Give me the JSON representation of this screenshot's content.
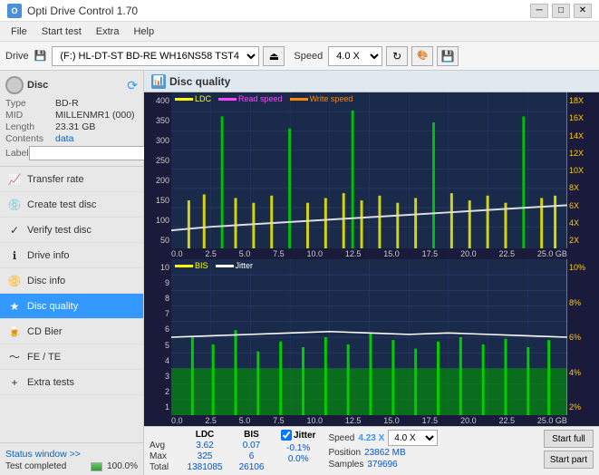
{
  "titlebar": {
    "app_name": "Opti Drive Control 1.70",
    "icon": "O"
  },
  "menu": {
    "items": [
      "File",
      "Start test",
      "Extra",
      "Help"
    ]
  },
  "toolbar": {
    "drive_label": "Drive",
    "drive_value": "(F:)  HL-DT-ST BD-RE  WH16NS58 TST4",
    "speed_label": "Speed",
    "speed_value": "4.0 X"
  },
  "disc": {
    "title": "Disc",
    "type_label": "Type",
    "type_val": "BD-R",
    "mid_label": "MID",
    "mid_val": "MILLENMR1 (000)",
    "length_label": "Length",
    "length_val": "23.31 GB",
    "contents_label": "Contents",
    "contents_val": "data",
    "label_label": "Label",
    "label_val": ""
  },
  "nav": {
    "items": [
      {
        "id": "transfer-rate",
        "label": "Transfer rate",
        "icon": "↗"
      },
      {
        "id": "create-test-disc",
        "label": "Create test disc",
        "icon": "💿"
      },
      {
        "id": "verify-test-disc",
        "label": "Verify test disc",
        "icon": "✓"
      },
      {
        "id": "drive-info",
        "label": "Drive info",
        "icon": "ℹ"
      },
      {
        "id": "disc-info",
        "label": "Disc info",
        "icon": "📀"
      },
      {
        "id": "disc-quality",
        "label": "Disc quality",
        "icon": "★",
        "active": true
      },
      {
        "id": "cd-bier",
        "label": "CD Bier",
        "icon": "🍺"
      },
      {
        "id": "fe-te",
        "label": "FE / TE",
        "icon": "~"
      },
      {
        "id": "extra-tests",
        "label": "Extra tests",
        "icon": "+"
      }
    ]
  },
  "chart": {
    "title": "Disc quality",
    "legend_top": {
      "ldc": {
        "label": "LDC",
        "color": "#ffff00"
      },
      "read_speed": {
        "label": "Read speed",
        "color": "#ff44ff"
      },
      "write_speed": {
        "label": "Write speed",
        "color": "#ff8800"
      }
    },
    "legend_bottom": {
      "bis": {
        "label": "BIS",
        "color": "#ffff00"
      },
      "jitter": {
        "label": "Jitter",
        "color": "#ffffff"
      }
    },
    "top_y_left": [
      "400",
      "350",
      "300",
      "250",
      "200",
      "150",
      "100",
      "50"
    ],
    "top_y_right": [
      "18X",
      "16X",
      "14X",
      "12X",
      "10X",
      "8X",
      "6X",
      "4X",
      "2X"
    ],
    "bottom_y_left": [
      "10",
      "9",
      "8",
      "7",
      "6",
      "5",
      "4",
      "3",
      "2",
      "1"
    ],
    "bottom_y_right": [
      "10%",
      "8%",
      "6%",
      "4%",
      "2%"
    ],
    "x_labels": [
      "0.0",
      "2.5",
      "5.0",
      "7.5",
      "10.0",
      "12.5",
      "15.0",
      "17.5",
      "20.0",
      "22.5",
      "25.0 GB"
    ]
  },
  "stats": {
    "ldc_label": "LDC",
    "bis_label": "BIS",
    "jitter_label": "Jitter",
    "speed_label": "Speed",
    "speed_val": "4.23 X",
    "speed_dropdown": "4.0 X",
    "avg_label": "Avg",
    "avg_ldc": "3.62",
    "avg_bis": "0.07",
    "avg_jitter": "-0.1%",
    "max_label": "Max",
    "max_ldc": "325",
    "max_bis": "6",
    "max_jitter": "0.0%",
    "total_label": "Total",
    "total_ldc": "1381085",
    "total_bis": "26106",
    "position_label": "Position",
    "position_val": "23862 MB",
    "samples_label": "Samples",
    "samples_val": "379696",
    "start_full": "Start full",
    "start_part": "Start part",
    "jitter_checked": true
  },
  "statusbar": {
    "status_window": "Status window >>",
    "status_text": "Test completed",
    "progress_pct": "100.0%",
    "progress_val": 100
  }
}
